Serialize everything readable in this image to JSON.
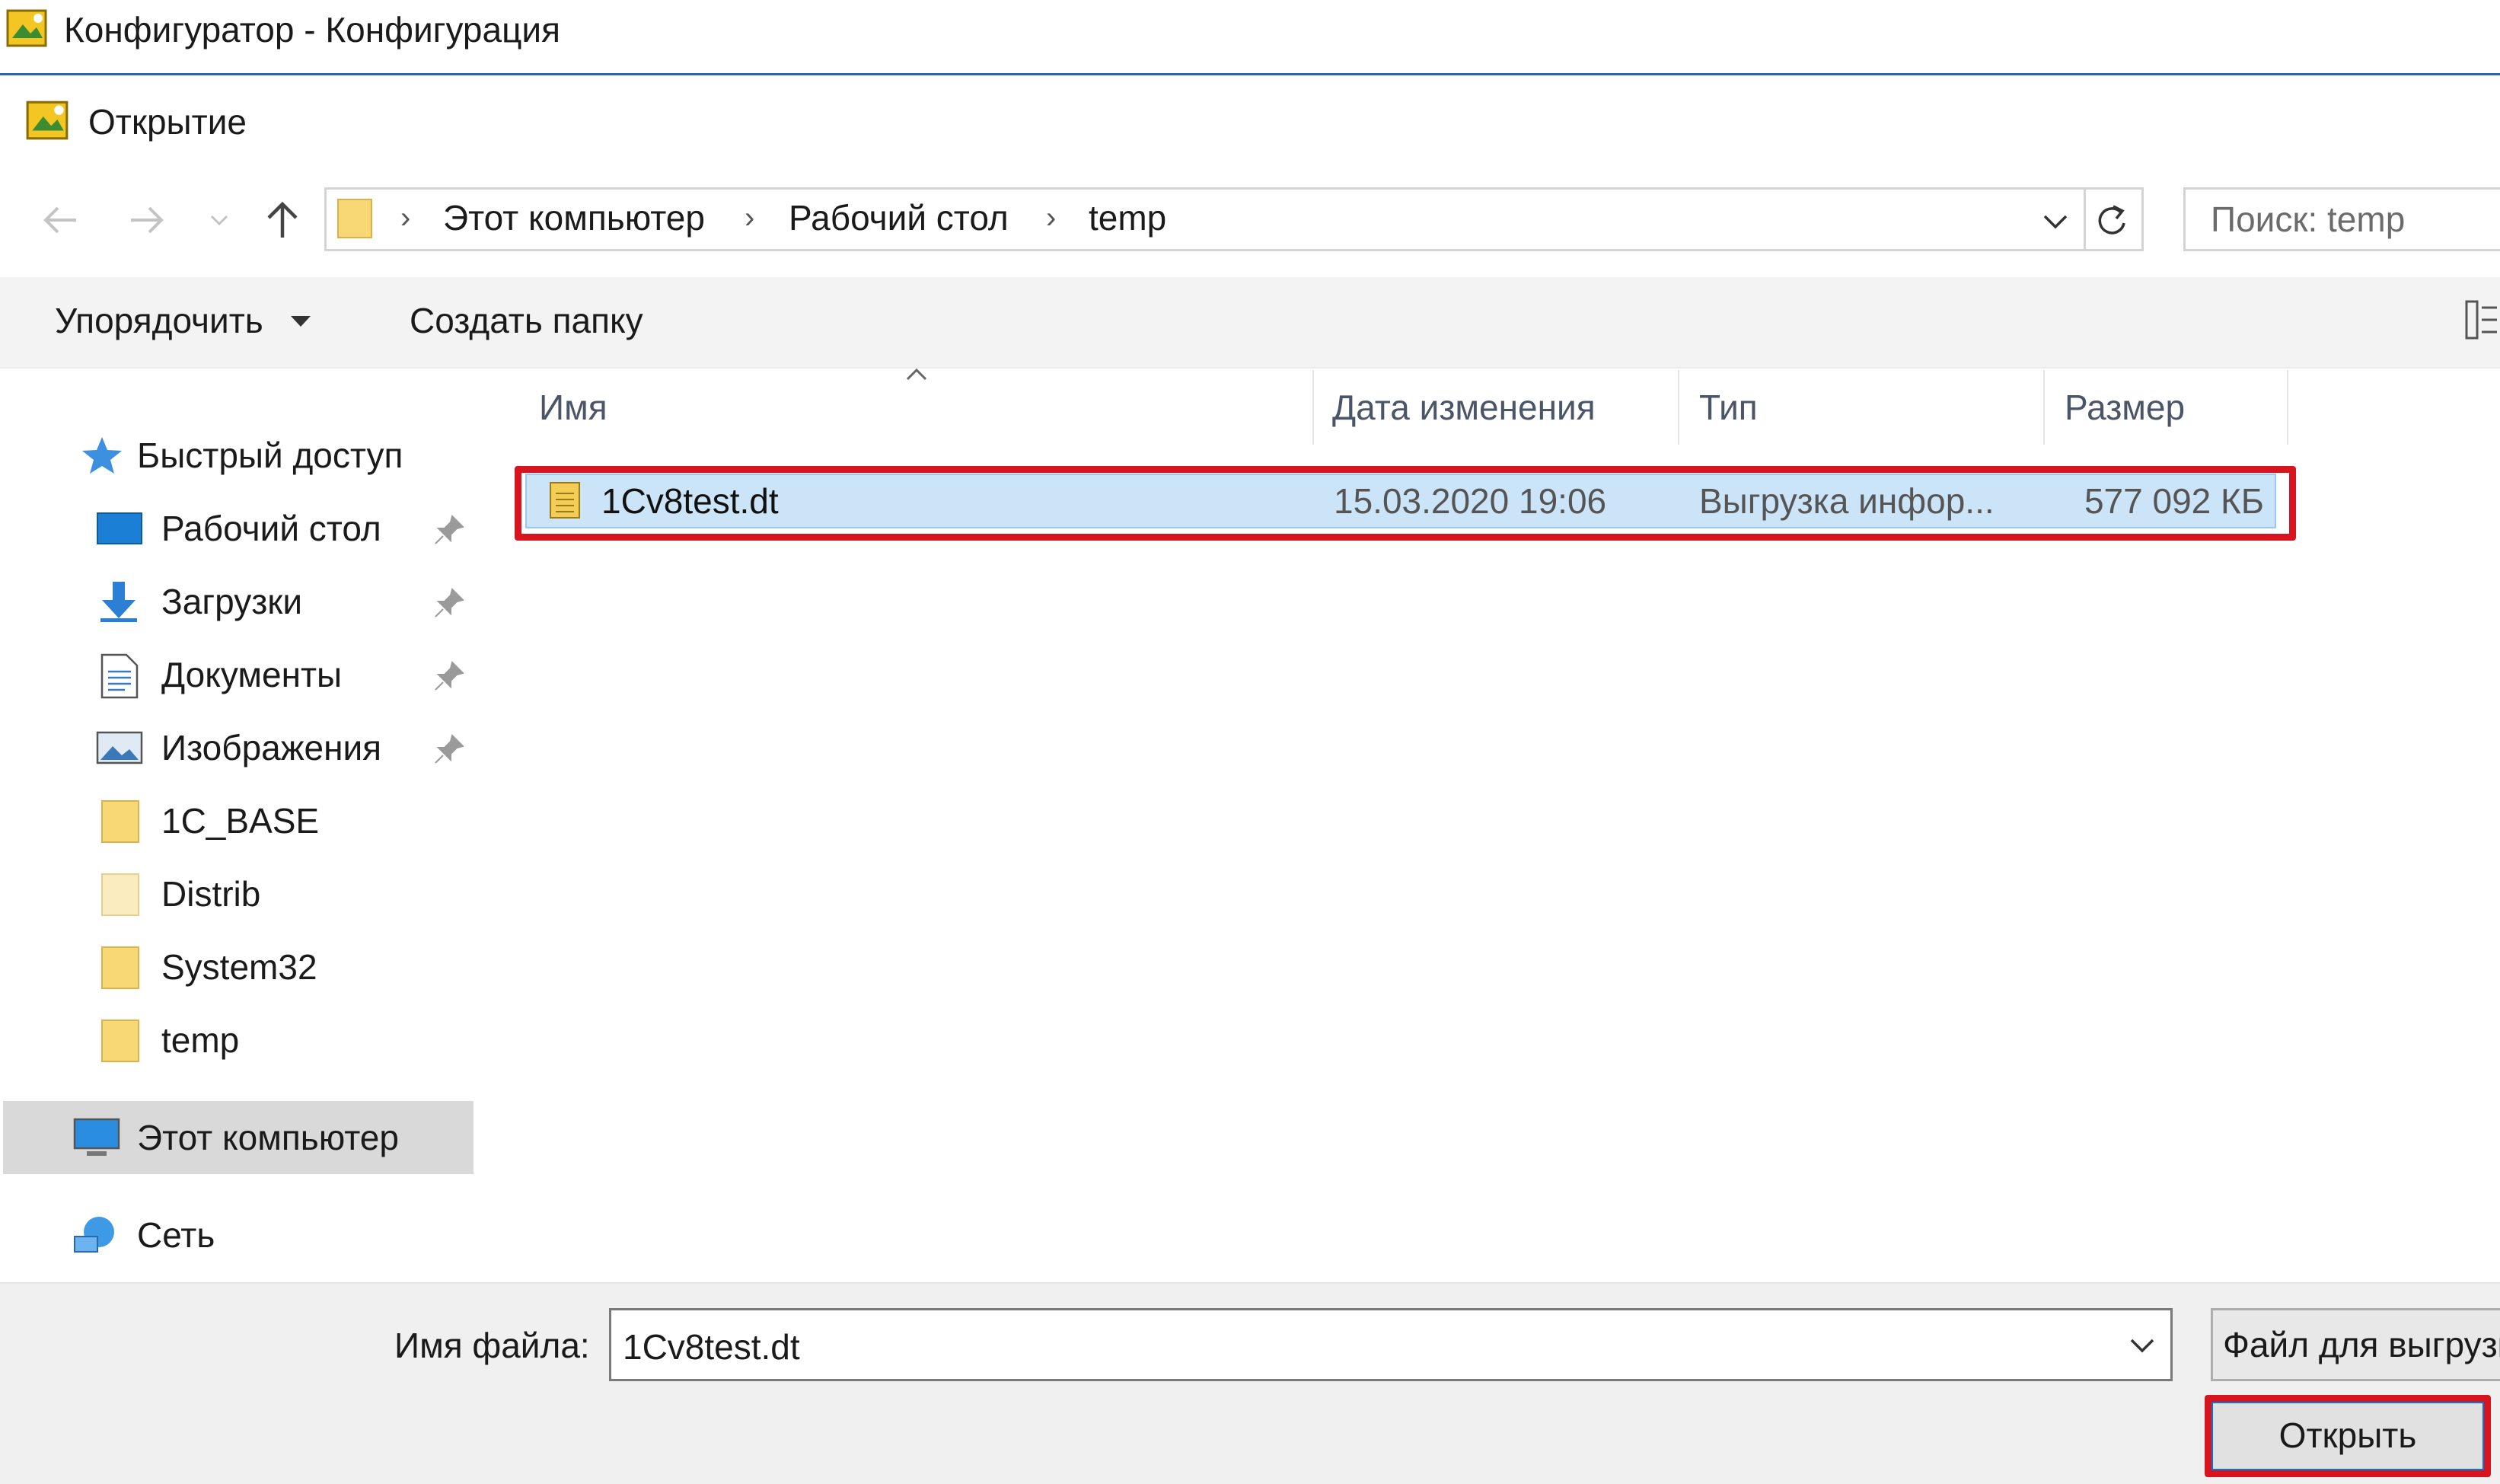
{
  "window": {
    "title": "Конфигуратор - Конфигурация",
    "icon": "1c-app-icon"
  },
  "dialog": {
    "title": "Открытие",
    "icon": "1c-app-icon"
  },
  "nav": {
    "back_icon": "arrow-left-icon",
    "forward_icon": "arrow-right-icon",
    "recent_icon": "chevron-down-icon",
    "up_icon": "arrow-up-icon",
    "breadcrumb": [
      "Этот компьютер",
      "Рабочий стол",
      "temp"
    ],
    "refresh_icon": "refresh-icon",
    "search_placeholder": "Поиск: temp"
  },
  "commands": {
    "organize_label": "Упорядочить",
    "new_folder_label": "Создать папку",
    "view_icon": "details-view-icon"
  },
  "sidebar": {
    "items": [
      {
        "label": "Быстрый доступ",
        "icon": "star-icon"
      },
      {
        "label": "Рабочий стол",
        "icon": "desktop-icon",
        "pinned": true
      },
      {
        "label": "Загрузки",
        "icon": "download-icon",
        "pinned": true
      },
      {
        "label": "Документы",
        "icon": "document-icon",
        "pinned": true
      },
      {
        "label": "Изображения",
        "icon": "pictures-icon",
        "pinned": true
      },
      {
        "label": "1C_BASE",
        "icon": "folder-icon"
      },
      {
        "label": "Distrib",
        "icon": "folder-icon"
      },
      {
        "label": "System32",
        "icon": "folder-icon"
      },
      {
        "label": "temp",
        "icon": "folder-icon"
      },
      {
        "label": "Этот компьютер",
        "icon": "computer-icon",
        "selected": true
      },
      {
        "label": "Сеть",
        "icon": "network-icon"
      }
    ]
  },
  "file_list": {
    "columns": [
      "Имя",
      "Дата изменения",
      "Тип",
      "Размер"
    ],
    "sort_column": "Имя",
    "rows": [
      {
        "name": "1Cv8test.dt",
        "modified": "15.03.2020 19:06",
        "type": "Выгрузка инфор...",
        "size": "577 092 КБ",
        "selected": true
      }
    ]
  },
  "footer": {
    "filename_label": "Имя файла:",
    "filename_value": "1Cv8test.dt",
    "filetype_value": "Файл для выгрузки",
    "open_label": "Открыть"
  },
  "colors": {
    "accent": "#0078d7",
    "highlight_annotation": "#d8141e",
    "selection_fill": "#cce4f7",
    "folder": "#f8d775"
  }
}
